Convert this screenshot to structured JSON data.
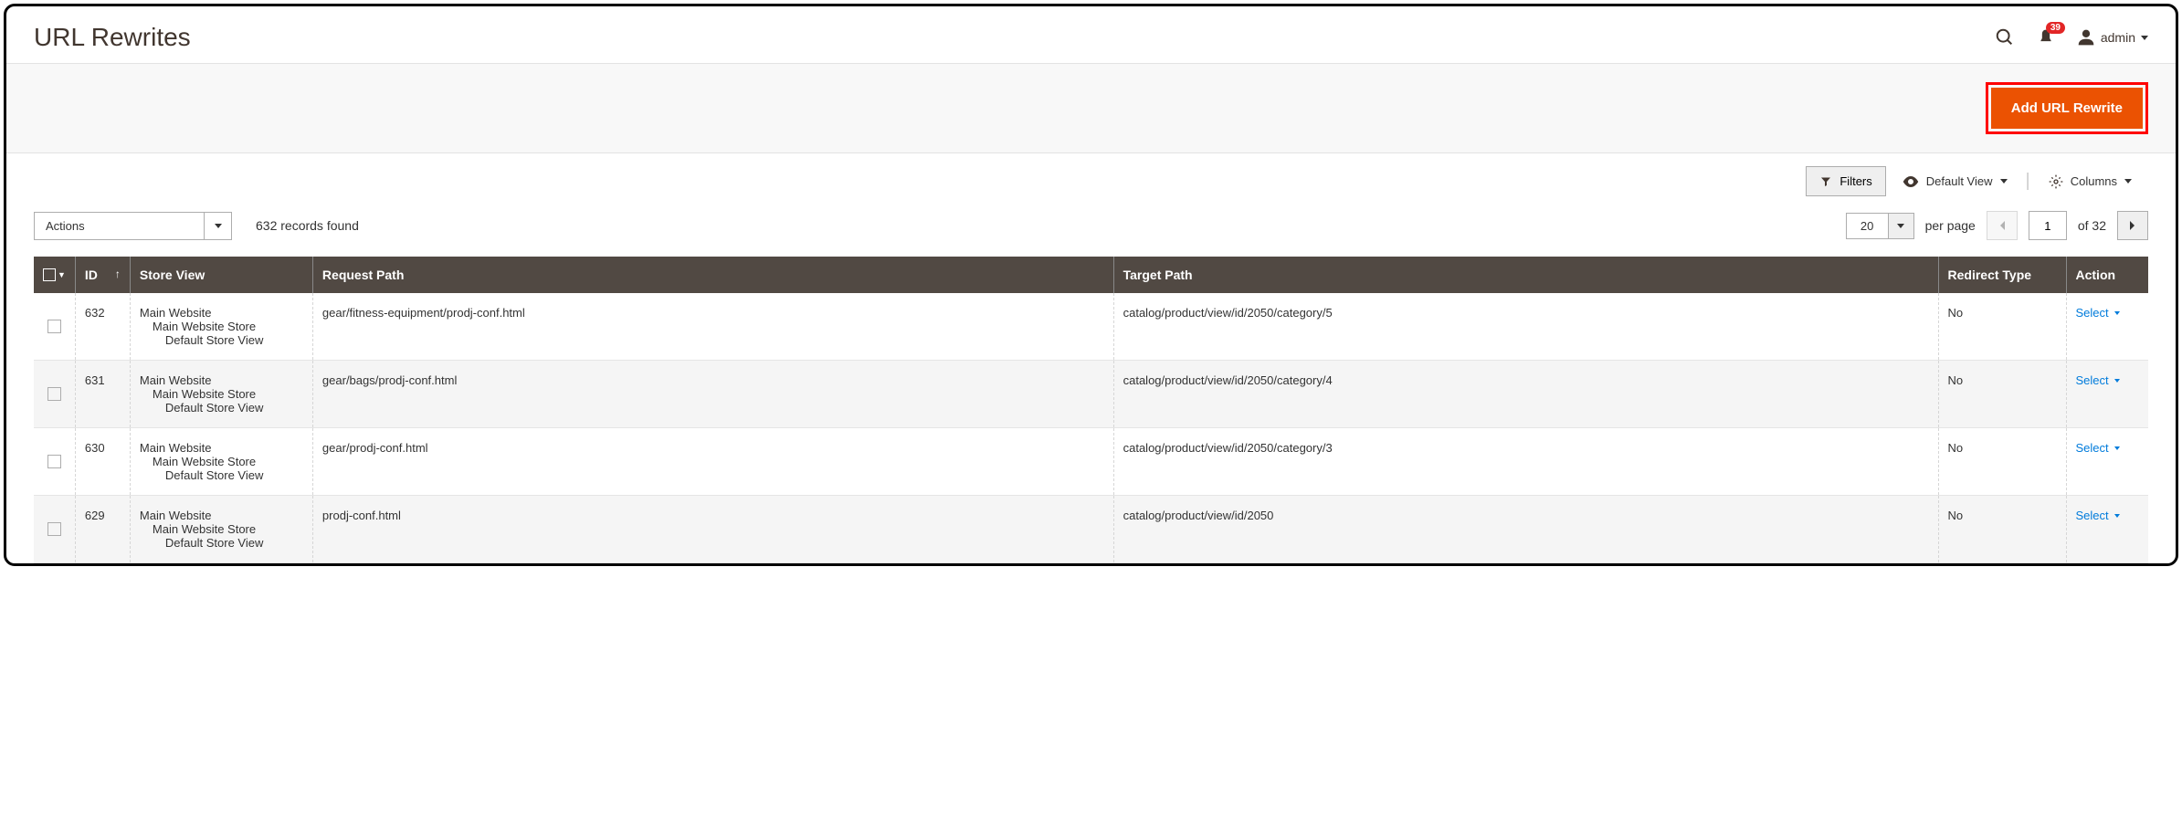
{
  "header": {
    "title": "URL Rewrites",
    "notification_count": "39",
    "username": "admin"
  },
  "toolbar": {
    "primary_button": "Add URL Rewrite"
  },
  "controls": {
    "filters": "Filters",
    "default_view": "Default View",
    "columns": "Columns"
  },
  "listing": {
    "actions_label": "Actions",
    "records_found": "632 records found",
    "per_page_value": "20",
    "per_page_label": "per page",
    "current_page": "1",
    "of_label": "of 32"
  },
  "columns": {
    "checkbox": "",
    "id": "ID",
    "store_view": "Store View",
    "request_path": "Request Path",
    "target_path": "Target Path",
    "redirect_type": "Redirect Type",
    "action": "Action"
  },
  "store_view_hierarchy": {
    "l1": "Main Website",
    "l2": "Main Website Store",
    "l3": "Default Store View"
  },
  "rows": [
    {
      "id": "632",
      "request_path": "gear/fitness-equipment/prodj-conf.html",
      "target_path": "catalog/product/view/id/2050/category/5",
      "redirect_type": "No",
      "action": "Select"
    },
    {
      "id": "631",
      "request_path": "gear/bags/prodj-conf.html",
      "target_path": "catalog/product/view/id/2050/category/4",
      "redirect_type": "No",
      "action": "Select"
    },
    {
      "id": "630",
      "request_path": "gear/prodj-conf.html",
      "target_path": "catalog/product/view/id/2050/category/3",
      "redirect_type": "No",
      "action": "Select"
    },
    {
      "id": "629",
      "request_path": "prodj-conf.html",
      "target_path": "catalog/product/view/id/2050",
      "redirect_type": "No",
      "action": "Select"
    }
  ]
}
